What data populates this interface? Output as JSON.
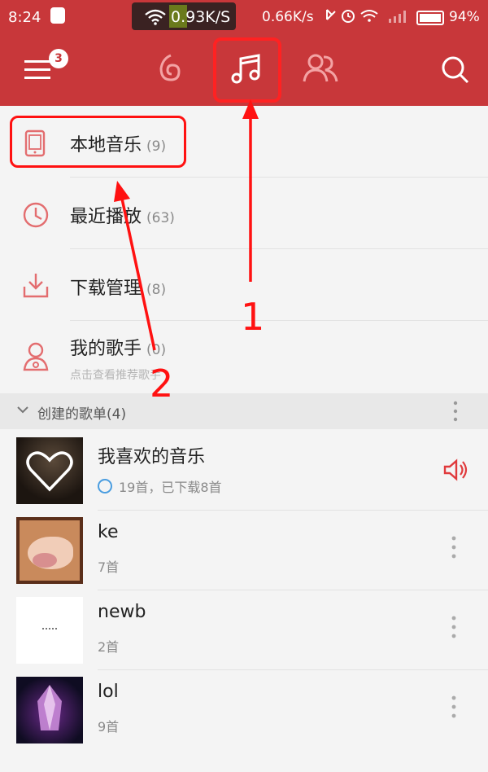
{
  "status_bar": {
    "time": "8:24",
    "net_speed_highlight": "0.93K/S",
    "net_speed": "0.66K/s",
    "battery": "94%"
  },
  "app_bar": {
    "menu_badge": "3",
    "tabs": [
      {
        "icon": "disc-icon",
        "active": false
      },
      {
        "icon": "music-note-icon",
        "active": true
      },
      {
        "icon": "friends-icon",
        "active": false
      }
    ],
    "accent": "#c8373a"
  },
  "menu_items": [
    {
      "label": "本地音乐",
      "count": "(9)",
      "icon": "phone-icon"
    },
    {
      "label": "最近播放",
      "count": "(63)",
      "icon": "clock-icon"
    },
    {
      "label": "下载管理",
      "count": "(8)",
      "icon": "download-icon"
    },
    {
      "label": "我的歌手",
      "count": "(0)",
      "icon": "singer-icon",
      "subtitle": "点击查看推荐歌手"
    }
  ],
  "playlists_section": {
    "title": "创建的歌单(4)"
  },
  "playlists": [
    {
      "title": "我喜欢的音乐",
      "subtitle": "19首，已下载8首",
      "cover": "heart-cover",
      "playing": true
    },
    {
      "title": "ke",
      "subtitle": "7首",
      "cover": "sleeping-cover",
      "playing": false
    },
    {
      "title": "newb",
      "subtitle": "2首",
      "cover": "white-cover",
      "playing": false
    },
    {
      "title": "lol",
      "subtitle": "9首",
      "cover": "crystal-cover",
      "playing": false
    }
  ],
  "annotations": {
    "label_1": "1",
    "label_2": "2",
    "color": "#ff1111"
  }
}
